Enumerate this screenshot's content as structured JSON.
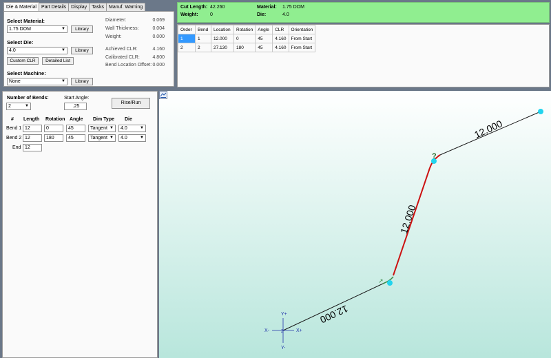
{
  "tabs": [
    "Die & Material",
    "Part Details",
    "Display",
    "Tasks",
    "Manuf. Warning"
  ],
  "die_material": {
    "select_material_label": "Select Material:",
    "material_value": "1.75 DOM",
    "select_die_label": "Select Die:",
    "die_value": "4.0",
    "select_machine_label": "Select Machine:",
    "machine_value": "None",
    "library_label": "Library",
    "custom_clr_label": "Custom CLR",
    "detailed_list_label": "Detailed List",
    "props": [
      {
        "label": "Diameter:",
        "value": "0.069"
      },
      {
        "label": "Wall Thickness:",
        "value": "0.004"
      },
      {
        "label": "Weight:",
        "value": "0.000"
      },
      {
        "label": "Achieved CLR:",
        "value": "4.160"
      },
      {
        "label": "Calibrated CLR:",
        "value": "4.800"
      },
      {
        "label": "Bend Location Offset:",
        "value": "0.000"
      }
    ]
  },
  "summary": {
    "cut_length_label": "Cut Length:",
    "cut_length_value": "42.260",
    "weight_label": "Weight:",
    "weight_value": "0",
    "material_label": "Material:",
    "material_value": "1.75 DOM",
    "die_label": "Die:",
    "die_value": "4.0"
  },
  "bend_table": {
    "columns": [
      "Order",
      "Bend",
      "Location",
      "Rotation",
      "Angle",
      "CLR",
      "Orientation"
    ],
    "rows": [
      [
        "1",
        "1",
        "12.000",
        "0",
        "45",
        "4.160",
        "From Start"
      ],
      [
        "2",
        "2",
        "27.130",
        "180",
        "45",
        "4.160",
        "From Start"
      ]
    ]
  },
  "editor": {
    "num_bends_label": "Number of Bends:",
    "num_bends_value": "2",
    "start_angle_label": "Start Angle:",
    "start_angle_value": ".25",
    "rise_run_label": "Rise/Run",
    "headers": [
      "#",
      "Length",
      "Rotation",
      "Angle",
      "Dim Type",
      "Die"
    ],
    "bends": [
      {
        "label": "Bend 1",
        "length": "12",
        "rotation": "0",
        "angle": "45",
        "dim_type": "Tangent",
        "die": "4.0"
      },
      {
        "label": "Bend 2",
        "length": "12",
        "rotation": "180",
        "angle": "45",
        "dim_type": "Tangent",
        "die": "4.0"
      }
    ],
    "end_label": "End",
    "end_value": "12"
  },
  "viewport": {
    "segment_labels": [
      "12.000",
      "12.000",
      "12.000"
    ],
    "bend_marker": "?",
    "axis_labels": {
      "y_plus": "Y+",
      "y_minus": "Y-",
      "x_plus": "X+",
      "x_minus": "X-",
      "origin": "Z"
    },
    "colors": {
      "background_top": "#ffffff",
      "background_bottom": "#b8e6dc",
      "tube": "#1a1a1a",
      "bend": "#cc1111",
      "node": "#22d4ee",
      "axis": "#2233aa"
    }
  }
}
